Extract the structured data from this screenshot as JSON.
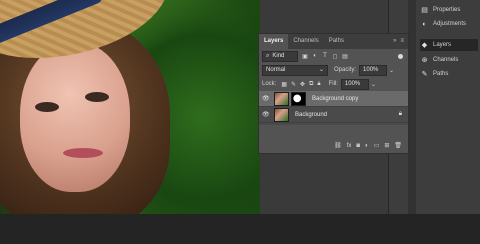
{
  "dock": {
    "items": [
      {
        "label": "Properties",
        "icon": "properties-icon",
        "active": false
      },
      {
        "label": "Adjustments",
        "icon": "adjustments-icon",
        "active": false
      },
      {
        "label": "Layers",
        "icon": "layers-icon",
        "active": true
      },
      {
        "label": "Channels",
        "icon": "channels-icon",
        "active": false
      },
      {
        "label": "Paths",
        "icon": "paths-icon",
        "active": false
      }
    ]
  },
  "layers_panel": {
    "tabs": [
      "Layers",
      "Channels",
      "Paths"
    ],
    "filter_label": "Kind",
    "blend_mode": "Normal",
    "opacity_label": "Opacity:",
    "opacity_value": "100%",
    "lock_label": "Lock:",
    "fill_label": "Fill:",
    "fill_value": "100%",
    "layers": [
      {
        "name": "Background copy",
        "selected": true,
        "has_mask": true,
        "locked": false
      },
      {
        "name": "Background",
        "selected": false,
        "has_mask": false,
        "locked": true
      }
    ]
  },
  "colors": {
    "panel_bg": "#535353",
    "tab_bar": "#3d3d3d",
    "dock_bg": "#3d3d3d",
    "selected_layer": "#6a6a6a"
  }
}
